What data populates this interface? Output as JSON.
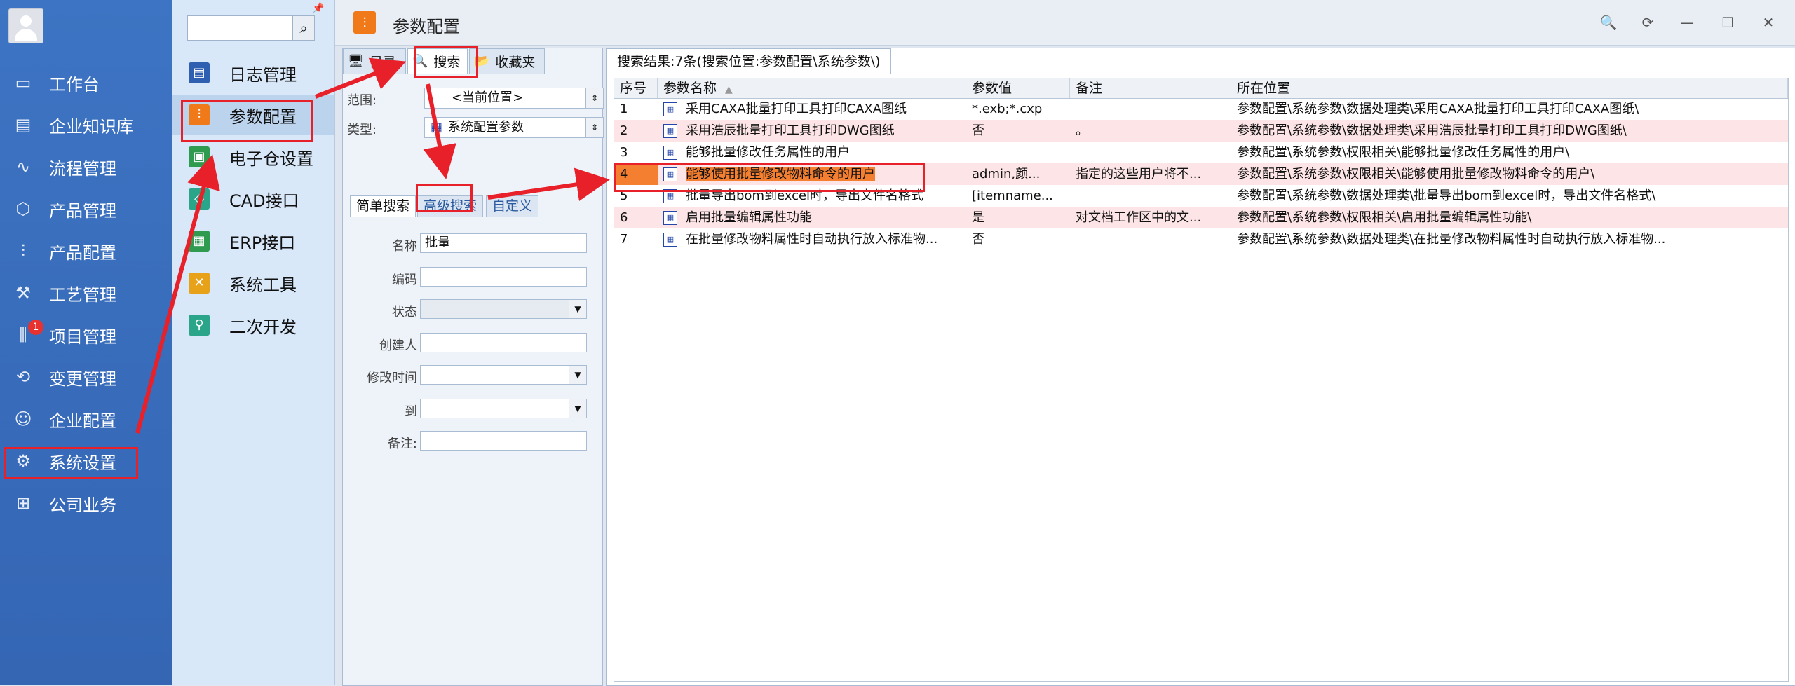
{
  "left_nav": {
    "items": [
      {
        "label": "工作台",
        "icon": "monitor-icon",
        "glyph": "▭"
      },
      {
        "label": "企业知识库",
        "icon": "book-icon",
        "glyph": "▤"
      },
      {
        "label": "流程管理",
        "icon": "flow-icon",
        "glyph": "∿"
      },
      {
        "label": "产品管理",
        "icon": "cube-icon",
        "glyph": "⬡"
      },
      {
        "label": "产品配置",
        "icon": "sliders-icon",
        "glyph": "⫶"
      },
      {
        "label": "工艺管理",
        "icon": "wrench-icon",
        "glyph": "⚒"
      },
      {
        "label": "项目管理",
        "icon": "project-icon",
        "glyph": "⫼",
        "badge": "1"
      },
      {
        "label": "变更管理",
        "icon": "change-icon",
        "glyph": "⟲"
      },
      {
        "label": "企业配置",
        "icon": "user-icon",
        "glyph": "☺"
      },
      {
        "label": "系统设置",
        "icon": "gear-icon",
        "glyph": "⚙"
      },
      {
        "label": "公司业务",
        "icon": "grid-icon",
        "glyph": "⊞"
      }
    ]
  },
  "sub_nav": {
    "search_placeholder": "",
    "items": [
      {
        "label": "日志管理",
        "icon": "log-icon",
        "color": "#2f5fb0",
        "glyph": "▤"
      },
      {
        "label": "参数配置",
        "icon": "sliders-icon",
        "color": "#f07a1a",
        "glyph": "⫶"
      },
      {
        "label": "电子仓设置",
        "icon": "storage-icon",
        "color": "#2e9b4f",
        "glyph": "▣"
      },
      {
        "label": "CAD接口",
        "icon": "cad-icon",
        "color": "#2aa58a",
        "glyph": "◇"
      },
      {
        "label": "ERP接口",
        "icon": "erp-icon",
        "color": "#2e9b4f",
        "glyph": "▦"
      },
      {
        "label": "系统工具",
        "icon": "tools-icon",
        "color": "#e8a21a",
        "glyph": "✕"
      },
      {
        "label": "二次开发",
        "icon": "dev-icon",
        "color": "#2aa58a",
        "glyph": "⚲"
      }
    ]
  },
  "window": {
    "title": "参数配置",
    "buttons": [
      "🔍",
      "⟳",
      "—",
      "☐",
      "✕"
    ]
  },
  "left_panel": {
    "tabs": [
      "目录",
      "搜索",
      "收藏夹"
    ],
    "scope_label": "范围:",
    "scope_value": "<当前位置>",
    "type_label": "类型:",
    "type_value": "系统配置参数",
    "sub_tabs": [
      "简单搜索",
      "高级搜索",
      "自定义"
    ],
    "fields": [
      {
        "label": "名称",
        "value": "批量"
      },
      {
        "label": "编码",
        "value": ""
      },
      {
        "label": "状态",
        "value": ""
      },
      {
        "label": "创建人",
        "value": ""
      },
      {
        "label": "修改时间",
        "value": ""
      },
      {
        "label": "到",
        "value": ""
      },
      {
        "label": "备注:",
        "value": ""
      }
    ]
  },
  "results": {
    "tab_label": "搜索结果:7条(搜索位置:参数配置\\系统参数\\)",
    "columns": [
      "序号",
      "参数名称",
      "参数值",
      "备注",
      "所在位置"
    ],
    "rows": [
      {
        "seq": "1",
        "name": "采用CAXA批量打印工具打印CAXA图纸",
        "value": "*.exb;*.cxp",
        "note": "",
        "location": "参数配置\\系统参数\\数据处理类\\采用CAXA批量打印工具打印CAXA图纸\\"
      },
      {
        "seq": "2",
        "name": "采用浩辰批量打印工具打印DWG图纸",
        "value": "否",
        "note": "。",
        "location": "参数配置\\系统参数\\数据处理类\\采用浩辰批量打印工具打印DWG图纸\\"
      },
      {
        "seq": "3",
        "name": "能够批量修改任务属性的用户",
        "value": "",
        "note": "",
        "location": "参数配置\\系统参数\\权限相关\\能够批量修改任务属性的用户\\"
      },
      {
        "seq": "4",
        "name": "能够使用批量修改物料命令的用户",
        "value": "admin,颜...",
        "note": "指定的这些用户将不...",
        "location": "参数配置\\系统参数\\权限相关\\能够使用批量修改物料命令的用户\\"
      },
      {
        "seq": "5",
        "name": "批量导出bom到excel时，导出文件名格式",
        "value": "[itemname...",
        "note": "",
        "location": "参数配置\\系统参数\\数据处理类\\批量导出bom到excel时，导出文件名格式\\"
      },
      {
        "seq": "6",
        "name": "启用批量编辑属性功能",
        "value": "是",
        "note": "对文档工作区中的文...",
        "location": "参数配置\\系统参数\\权限相关\\启用批量编辑属性功能\\"
      },
      {
        "seq": "7",
        "name": "在批量修改物料属性时自动执行放入标准物...",
        "value": "否",
        "note": "",
        "location": "参数配置\\系统参数\\数据处理类\\在批量修改物料属性时自动执行放入标准物..."
      }
    ]
  },
  "colors": {
    "nav_bg": "#3a6fbf",
    "accent_orange": "#f47f30",
    "annotation_red": "#e8202a",
    "row_pink": "#fde5e7"
  }
}
